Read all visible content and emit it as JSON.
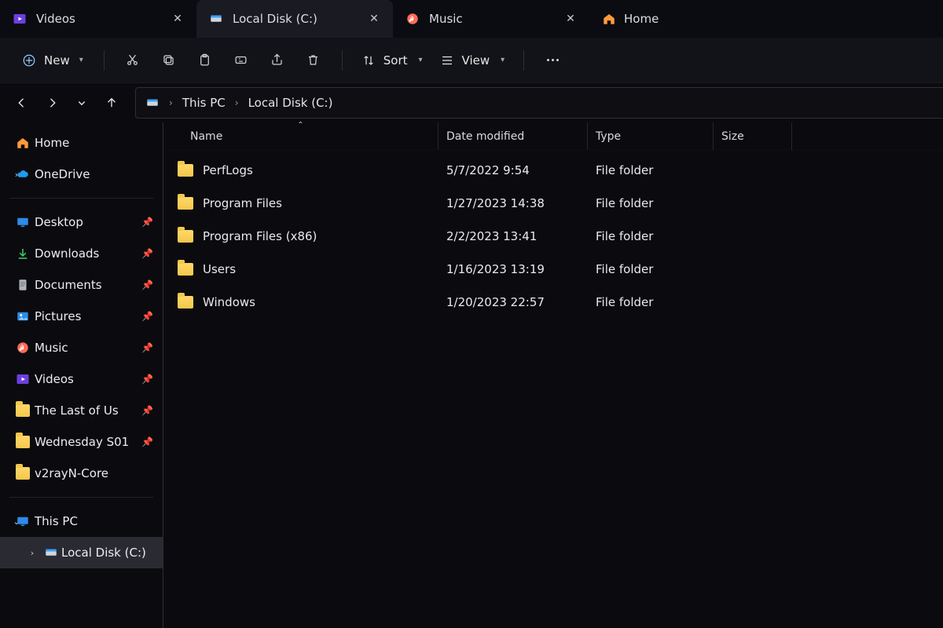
{
  "tabs": [
    {
      "label": "Videos"
    },
    {
      "label": "Local Disk (C:)"
    },
    {
      "label": "Music"
    },
    {
      "label": "Home"
    }
  ],
  "toolbar": {
    "new_label": "New",
    "sort_label": "Sort",
    "view_label": "View"
  },
  "breadcrumb": {
    "root": "This PC",
    "loc": "Local Disk (C:)"
  },
  "sidebar": {
    "home": "Home",
    "onedrive": "OneDrive",
    "quick": [
      {
        "label": "Desktop",
        "icon": "desktop",
        "pinned": true
      },
      {
        "label": "Downloads",
        "icon": "download",
        "pinned": true
      },
      {
        "label": "Documents",
        "icon": "document",
        "pinned": true
      },
      {
        "label": "Pictures",
        "icon": "picture",
        "pinned": true
      },
      {
        "label": "Music",
        "icon": "music",
        "pinned": true
      },
      {
        "label": "Videos",
        "icon": "video",
        "pinned": true
      },
      {
        "label": "The Last of Us",
        "icon": "folder",
        "pinned": true
      },
      {
        "label": "Wednesday S01",
        "icon": "folder",
        "pinned": true
      },
      {
        "label": "v2rayN-Core",
        "icon": "folder",
        "pinned": false
      }
    ],
    "thispc": "This PC",
    "drive": "Local Disk (C:)"
  },
  "columns": {
    "name": "Name",
    "date": "Date modified",
    "type": "Type",
    "size": "Size"
  },
  "rows": [
    {
      "name": "PerfLogs",
      "date": "5/7/2022 9:54",
      "type": "File folder",
      "size": ""
    },
    {
      "name": "Program Files",
      "date": "1/27/2023 14:38",
      "type": "File folder",
      "size": ""
    },
    {
      "name": "Program Files (x86)",
      "date": "2/2/2023 13:41",
      "type": "File folder",
      "size": ""
    },
    {
      "name": "Users",
      "date": "1/16/2023 13:19",
      "type": "File folder",
      "size": ""
    },
    {
      "name": "Windows",
      "date": "1/20/2023 22:57",
      "type": "File folder",
      "size": ""
    }
  ]
}
